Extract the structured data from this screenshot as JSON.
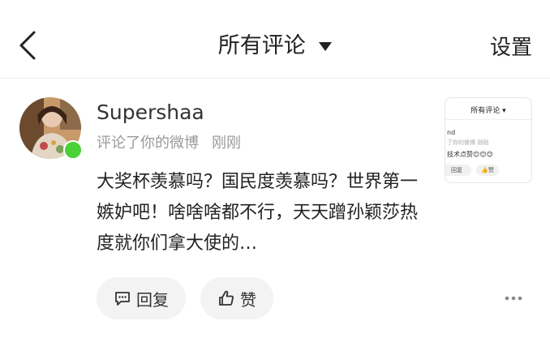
{
  "header": {
    "title": "所有评论",
    "settings_label": "设置",
    "back_icon": "chevron-left-icon",
    "dropdown_icon": "caret-down-icon"
  },
  "comment": {
    "username": "Supershaa",
    "action_text": "评论了你的微博",
    "time_text": "刚刚",
    "content": "大奖杯羡慕吗？国民度羡慕吗？世界第一嫉妒吧！啥啥啥都不行，天天蹭孙颖莎热度就你们拿大使的…",
    "online_color": "#4cd137",
    "reply_label": "回复",
    "like_label": "赞"
  },
  "thumbnail": {
    "title": "所有评论",
    "name_fragment": "nd",
    "meta_fragment": "了你的微博  刚刚",
    "text_fragment": "技术点赞😊😊😊",
    "reply_fragment": "回复",
    "like_fragment": "赞"
  },
  "colors": {
    "background": "#ffffff",
    "pill_bg": "#f3f3f3",
    "muted_text": "#9a9a9a"
  }
}
